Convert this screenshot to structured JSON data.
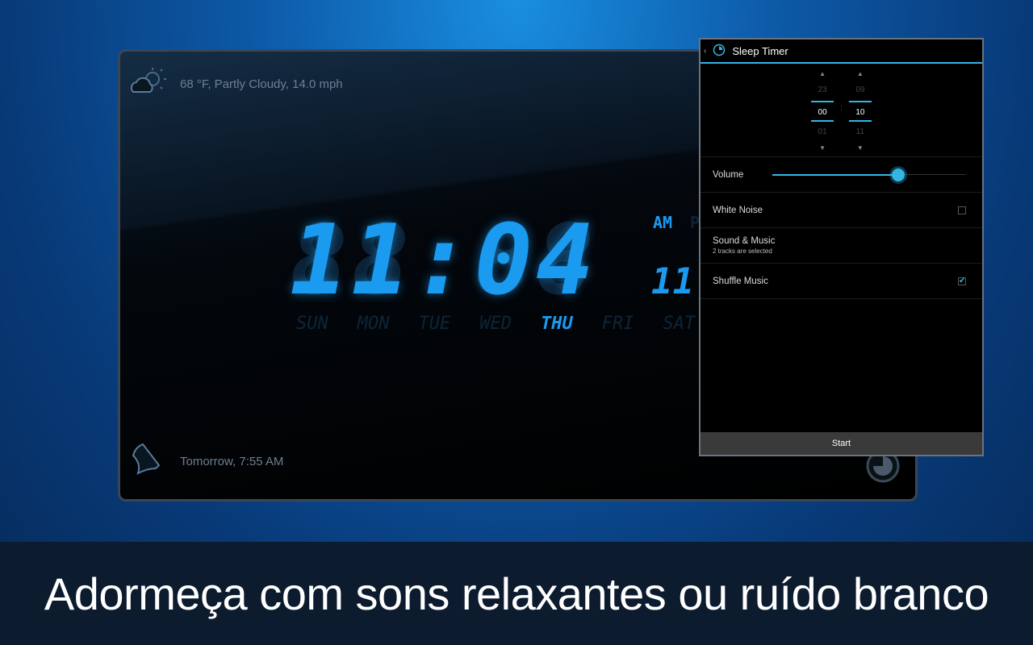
{
  "screen": {
    "weather": {
      "icon": "partly-cloudy-icon",
      "text": "68 °F, Partly Cloudy, 14.0 mph"
    },
    "clock": {
      "time": "11:04",
      "ghost": "88:88",
      "ampm": "AM",
      "pm_ghost": "PM",
      "seconds": "11",
      "days": [
        "SUN",
        "MON",
        "TUE",
        "WED",
        "THU",
        "FRI",
        "SAT"
      ],
      "active_day": "THU"
    },
    "alarm": {
      "icon": "bell-icon",
      "text": "Tomorrow, 7:55 AM"
    },
    "timer_icon": "sleep-timer-icon"
  },
  "panel": {
    "title": "Sleep Timer",
    "picker": {
      "hours": {
        "prev": "23",
        "current": "00",
        "next": "01"
      },
      "minutes": {
        "prev": "09",
        "current": "10",
        "next": "11"
      },
      "separator": ":"
    },
    "volume": {
      "label": "Volume",
      "value": 0.65
    },
    "white_noise": {
      "label": "White Noise",
      "checked": false
    },
    "sound_music": {
      "label": "Sound & Music",
      "sub": "2 tracks are selected"
    },
    "shuffle": {
      "label": "Shuffle Music",
      "checked": true
    },
    "start_label": "Start"
  },
  "caption": "Adormeça com sons relaxantes ou ruído branco",
  "colors": {
    "accent": "#33b5e5",
    "clock": "#1a9bf0"
  }
}
